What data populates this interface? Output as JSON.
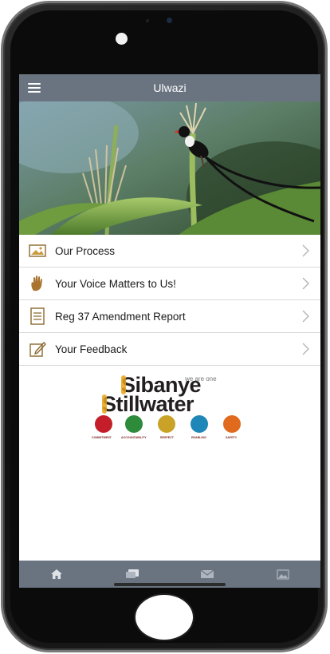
{
  "app": {
    "title": "Ulwazi"
  },
  "menu": {
    "items": [
      {
        "label": "Our Process",
        "icon": "photo-frame-icon"
      },
      {
        "label": "Your Voice Matters to Us!",
        "icon": "raised-hand-icon"
      },
      {
        "label": "Reg 37 Amendment Report",
        "icon": "document-icon"
      },
      {
        "label": "Your Feedback",
        "icon": "edit-icon"
      }
    ]
  },
  "logo": {
    "tagline": "we are one",
    "line1": "Sibanye",
    "line2": "Stillwater",
    "values": [
      {
        "label": "COMMITMENT",
        "color": "#c41e2a"
      },
      {
        "label": "ACCOUNTABILITY",
        "color": "#2e8b3a"
      },
      {
        "label": "RESPECT",
        "color": "#c9a227"
      },
      {
        "label": "ENABLING",
        "color": "#1f86b8"
      },
      {
        "label": "SAFETY",
        "color": "#e06a1e"
      }
    ]
  },
  "tabs": [
    {
      "icon": "home-icon"
    },
    {
      "icon": "chat-icon"
    },
    {
      "icon": "mail-icon"
    },
    {
      "icon": "image-icon"
    }
  ],
  "colors": {
    "bar": "#6a7481",
    "brand_orange": "#e8a21a",
    "brand_dark": "#231f20"
  }
}
